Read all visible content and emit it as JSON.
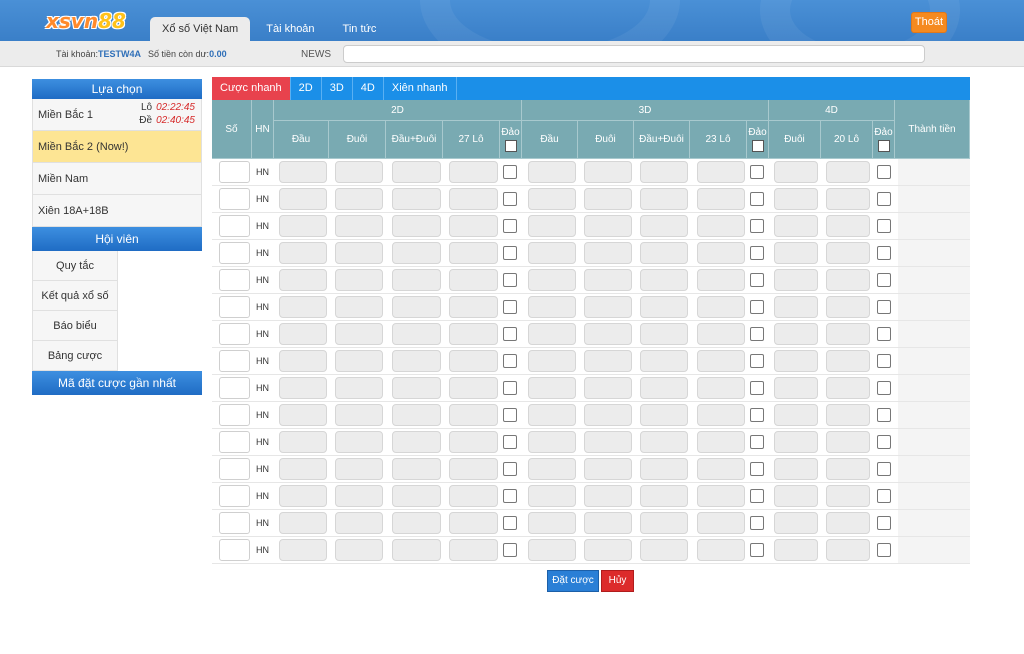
{
  "header": {
    "logo_part1": "xsvn",
    "logo_part2": "88",
    "tabs": [
      {
        "label": "Xổ số Việt Nam",
        "active": true
      },
      {
        "label": "Tài khoản",
        "active": false
      },
      {
        "label": "Tin tức",
        "active": false
      }
    ],
    "logout_label": "Thoát"
  },
  "subbar": {
    "account_label": "Tài khoản:",
    "account_value": "TESTW4A",
    "balance_label": "Số tiền còn dư:",
    "balance_value": "0.00",
    "news_label": "NEWS"
  },
  "sidebar": {
    "choice_title": "Lựa chọn",
    "regions": [
      {
        "label": "Miền Bắc 1",
        "lo_label": "Lô",
        "lo_time": "02:22:45",
        "de_label": "Đề",
        "de_time": "02:40:45"
      },
      {
        "label": "Miền Bắc 2 (Now!)",
        "selected": true
      },
      {
        "label": "Miền Nam"
      },
      {
        "label": "Xiên 18A+18B"
      }
    ],
    "member_title": "Hội viên",
    "member_links": [
      "Quy tắc",
      "Kết quả xổ số",
      "Báo biểu",
      "Bảng cược"
    ],
    "recent_title": "Mã đặt cược gần nhất"
  },
  "bet_tabs": [
    {
      "label": "Cược nhanh",
      "active": true
    },
    {
      "label": "2D"
    },
    {
      "label": "3D"
    },
    {
      "label": "4D"
    },
    {
      "label": "Xiên nhanh"
    }
  ],
  "table": {
    "col_so": "Số",
    "col_hn": "HN",
    "group_2d": "2D",
    "group_3d": "3D",
    "group_4d": "4D",
    "col_thanh_tien": "Thành tiền",
    "sub_2d": [
      "Đầu",
      "Đuôi",
      "Đầu+Đuôi",
      "27 Lô",
      "Đảo"
    ],
    "sub_3d": [
      "Đầu",
      "Đuôi",
      "Đầu+Đuôi",
      "23 Lô",
      "Đảo"
    ],
    "sub_4d": [
      "Đuôi",
      "20 Lô",
      "Đảo"
    ],
    "row_label": "HN",
    "row_count": 15
  },
  "actions": {
    "bet_label": "Đặt cược",
    "cancel_label": "Hủy"
  },
  "colors": {
    "header_blue": "#3a7fc8",
    "tab_blue": "#1b8fe8",
    "tab_active_red": "#e8424d",
    "table_header": "#79aab2",
    "selected_yellow": "#fde594",
    "logout_orange": "#f58a1f"
  }
}
